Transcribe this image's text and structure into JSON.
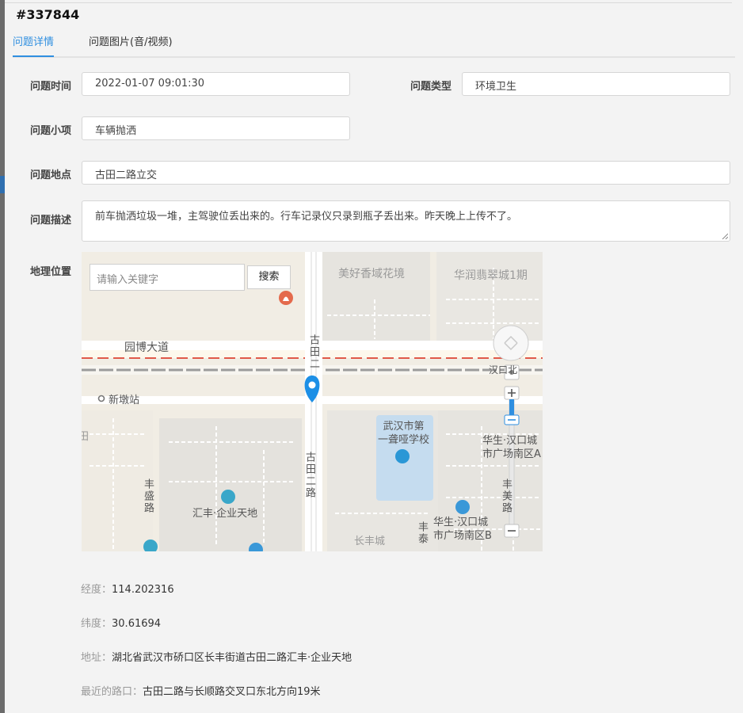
{
  "header": {
    "id": "#337844"
  },
  "tabs": [
    {
      "label": "问题详情",
      "active": true
    },
    {
      "label": "问题图片(音/视频)",
      "active": false
    }
  ],
  "form": {
    "time": {
      "label": "问题时间",
      "value": "2022-01-07 09:01:30"
    },
    "type": {
      "label": "问题类型",
      "value": "环境卫生"
    },
    "subitem": {
      "label": "问题小项",
      "value": "车辆抛洒"
    },
    "location": {
      "label": "问题地点",
      "value": "古田二路立交"
    },
    "description": {
      "label": "问题描述",
      "value": "前车抛洒垃圾一堆，主驾驶位丢出来的。行车记录仪只录到瓶子丢出来。昨天晚上上传不了。"
    },
    "geo": {
      "label": "地理位置"
    }
  },
  "map": {
    "search_placeholder": "请输入关键字",
    "search_button": "搜索",
    "labels": {
      "meihao": "美好香域花境",
      "huarun": "华润翡翠城1期",
      "yuanbo": "园博大道",
      "xindun": "新墩站",
      "gutian_top": "古田二",
      "gutian_mid": "古田二路",
      "hankou": "汉口北",
      "school": "武汉市第\n一聋哑学校",
      "huasheng_a": "华生·汉口城\n市广场南区A",
      "huasheng_b": "华生·汉口城\n市广场南区B",
      "huifeng": "汇丰·企业天地",
      "fengsheng": "丰盛路",
      "changfeng": "长丰城",
      "fengtai": "丰泰",
      "fengmei": "丰美路",
      "tian": "田"
    }
  },
  "info": {
    "lng": {
      "key": "经度：",
      "value": "114.202316"
    },
    "lat": {
      "key": "纬度：",
      "value": "30.61694"
    },
    "address": {
      "key": "地址：",
      "value": "湖北省武汉市硚口区长丰街道古田二路汇丰·企业天地"
    },
    "crossing": {
      "key": "最近的路口：",
      "value": "古田二路与长顺路交叉口东北方向19米"
    }
  },
  "colors": {
    "accent": "#2f8fe0",
    "marker": "#1c8fe6",
    "road_red": "#e05a4a"
  }
}
